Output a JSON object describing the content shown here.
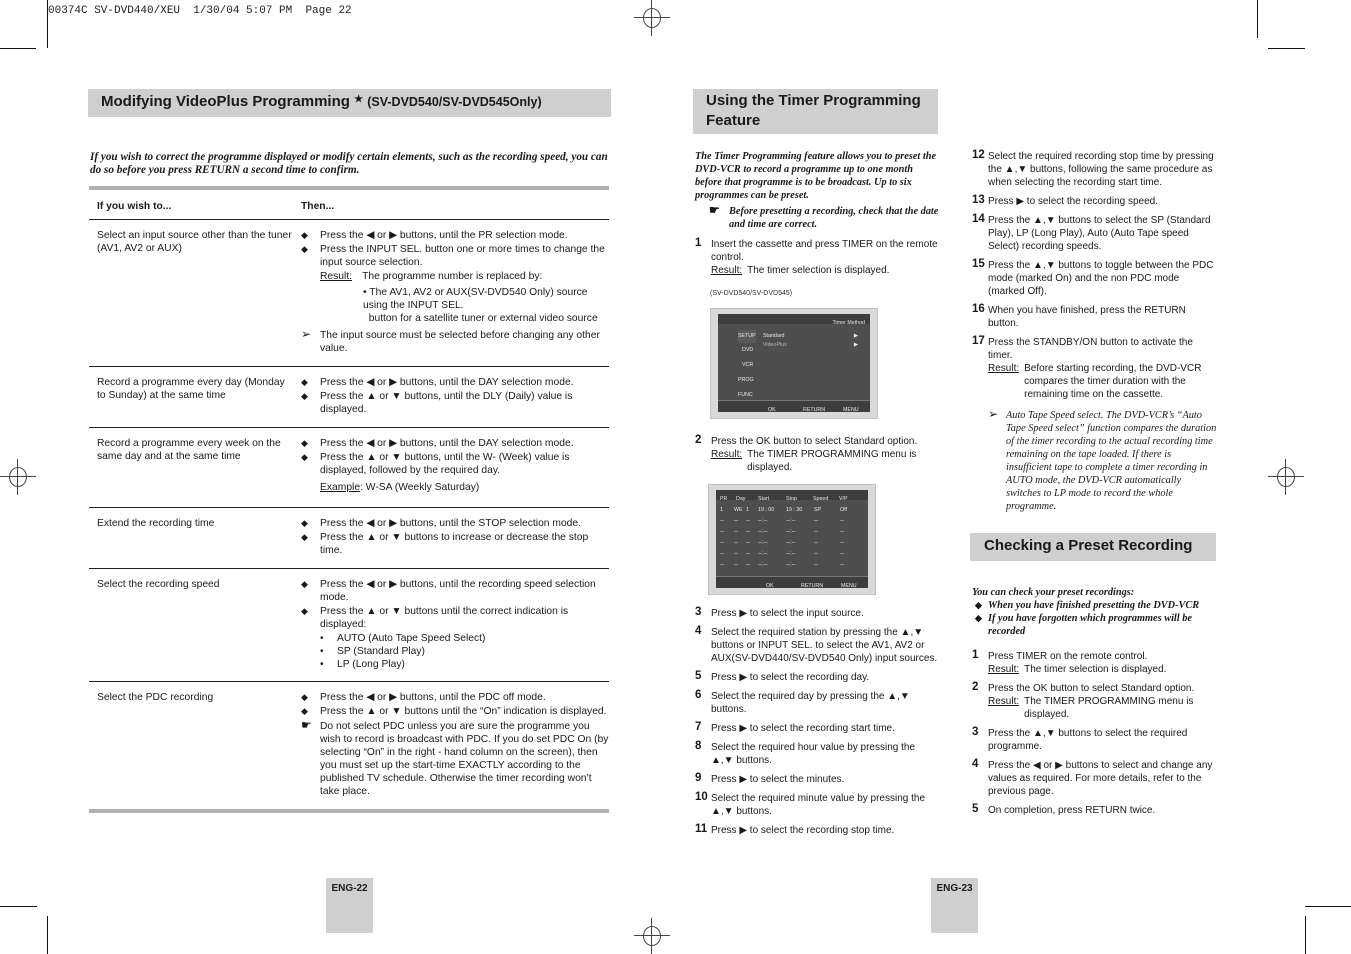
{
  "print_header": "00374C SV-DVD440/XEU  1/30/04 5:07 PM  Page 22",
  "left_page": {
    "title": "Modifying VideoPlus Programming",
    "title_star": "★",
    "title_suffix": "(SV-DVD540/SV-DVD545Only)",
    "intro": "If you wish to correct the programme displayed or modify certain elements, such as the recording speed, you can do so before you press RETURN a second time to confirm.",
    "table": {
      "headers": [
        "If you wish to...",
        "Then..."
      ],
      "rows": [
        {
          "wish": "Select an input source other than the tuner (AV1, AV2 or AUX)",
          "bullets": [
            "Press the ◀ or ▶ buttons, until the PR selection mode.",
            "Press the INPUT SEL. button one or more times to change the input source selection."
          ],
          "result_label": "Result:",
          "result_text": "The programme number is replaced by:",
          "sub_bullet_1": "The AV1, AV2 or AUX(SV-DVD540 Only) source using the INPUT SEL.",
          "sub_bullet_2": "button for a satellite tuner or external video source",
          "note": "The input source must be selected before changing any other value."
        },
        {
          "wish": "Record a programme every day (Monday to Sunday) at the same time",
          "bullets": [
            "Press the ◀ or ▶ buttons, until the DAY selection mode.",
            "Press the ▲ or ▼ buttons, until the DLY (Daily) value is displayed."
          ]
        },
        {
          "wish": "Record a programme every week on the same day and at the same time",
          "bullets": [
            "Press the ◀ or ▶ buttons, until the DAY selection mode.",
            "Press the ▲ or ▼ buttons, until the W- (Week) value is displayed, followed by the required day."
          ],
          "example_label": "Example",
          "example_text": "W-SA (Weekly Saturday)"
        },
        {
          "wish": "Extend the recording time",
          "bullets": [
            "Press the ◀ or ▶ buttons, until the STOP selection mode.",
            "Press the ▲ or ▼ buttons to increase or decrease the stop time."
          ]
        },
        {
          "wish": "Select the recording speed",
          "bullets": [
            "Press the ◀ or ▶ buttons, until the recording speed selection mode.",
            "Press the ▲ or ▼ buttons until the correct indication is displayed:"
          ],
          "speeds": [
            "AUTO (Auto Tape Speed Select)",
            "SP (Standard Play)",
            "LP (Long Play)"
          ]
        },
        {
          "wish": "Select the PDC recording",
          "bullets": [
            "Press the ◀ or ▶ buttons, until the PDC off mode.",
            "Press the ▲ or ▼ buttons until the “On” indication is displayed."
          ],
          "note": "Do not select PDC unless you are sure the programme you wish to record is broadcast with PDC. If you do set PDC On (by selecting “On” in the right - hand column on the screen), then you must set up the start-time EXACTLY according to the published TV schedule. Otherwise the timer recording won’t take place."
        }
      ]
    },
    "page_label": "ENG-22"
  },
  "right_page": {
    "timer_section": {
      "title": "Using the Timer Programming Feature",
      "intro": "The Timer Programming feature allows you to preset the DVD-VCR to record a programme up to one month before that programme is to be broadcast. Up to six programmes can be preset.",
      "note": "Before presetting a recording, check that the date and time are correct.",
      "steps": [
        {
          "n": "1",
          "text": "Insert the cassette and press TIMER on the remote control.",
          "result_label": "Result:",
          "result": "The timer selection is displayed."
        },
        {
          "n": "2",
          "text": "Press the OK button to select Standard option.",
          "result_label": "Result:",
          "result": "The TIMER PROGRAMMING menu is displayed."
        },
        {
          "n": "3",
          "text": "Press ▶ to select the input source."
        },
        {
          "n": "4",
          "text": "Select the required station by pressing the ▲,▼ buttons or INPUT SEL. to select the  AV1, AV2 or AUX(SV-DVD440/SV-DVD540 Only) input sources."
        },
        {
          "n": "5",
          "text": "Press ▶ to select the recording day."
        },
        {
          "n": "6",
          "text": "Select the required day by pressing the ▲,▼ buttons."
        },
        {
          "n": "7",
          "text": "Press ▶ to select the recording start time."
        },
        {
          "n": "8",
          "text": "Select the required hour value by pressing the ▲,▼ buttons."
        },
        {
          "n": "9",
          "text": "Press ▶ to select the minutes."
        },
        {
          "n": "10",
          "text": "Select the required minute value by pressing the ▲,▼ buttons."
        },
        {
          "n": "11",
          "text": "Press ▶ to select the recording stop time."
        },
        {
          "n": "12",
          "text": "Select the required recording stop time by pressing the ▲,▼ buttons, following the same procedure as when selecting the recording start time."
        },
        {
          "n": "13",
          "text": "Press ▶ to select the recording speed."
        },
        {
          "n": "14",
          "text": "Press the ▲,▼ buttons to select the SP (Standard Play), LP (Long Play), Auto (Auto Tape speed Select) recording speeds."
        },
        {
          "n": "15",
          "text": "Press the ▲,▼ buttons to toggle between the PDC mode (marked On) and the non PDC mode (marked Off)."
        },
        {
          "n": "16",
          "text": "When you have finished, press the RETURN button."
        },
        {
          "n": "17",
          "text": "Press the STANDBY/ON button to activate the timer.",
          "result_label": "Result:",
          "result": "Before starting recording, the DVD-VCR compares the timer duration with the remaining time on the cassette."
        }
      ],
      "model_note": "(SV-DVD540/SV-DVD545)",
      "auto_note": "Auto Tape Speed select. The DVD-VCR’s “Auto Tape Speed select” function compares the duration of the timer recording to the actual recording time remaining on the tape loaded. If there is insufficient tape to complete a timer recording in AUTO mode, the DVD-VCR automatically switches to LP mode to record the whole programme."
    },
    "screen_timer_method": {
      "header": "Timer Method",
      "menu_items": [
        "SETUP",
        "DVD",
        "VCR",
        "PROG",
        "FUNC"
      ],
      "options": [
        "Standard",
        "VideoPlus"
      ],
      "footer": [
        "OK",
        "RETURN",
        "MENU"
      ]
    },
    "screen_timer_programming": {
      "columns": [
        "PR",
        "Day",
        "Start",
        "Stop",
        "Speed",
        "V/P"
      ],
      "first_row": [
        "1",
        "WE",
        "1",
        "19 : 00",
        "19 : 30",
        "SP",
        "Off"
      ],
      "empty_row": [
        "--",
        "--",
        "--",
        "--:--",
        "--:--",
        "--",
        "--"
      ],
      "empty_rows_count": 5,
      "footer": [
        "OK",
        "RETURN",
        "MENU"
      ]
    },
    "check_section": {
      "title": "Checking a Preset Recording",
      "intro": "You can check your preset recordings:",
      "bullets": [
        "When you have finished presetting the DVD-VCR",
        "If you have forgotten which programmes will be recorded"
      ],
      "steps": [
        {
          "n": "1",
          "text": "Press TIMER on the remote control.",
          "result_label": "Result:",
          "result": "The timer selection is displayed."
        },
        {
          "n": "2",
          "text": "Press the OK button to select Standard option.",
          "result_label": "Result:",
          "result": "The TIMER PROGRAMMING menu is displayed."
        },
        {
          "n": "3",
          "text": "Press the ▲,▼ buttons to select the required programme."
        },
        {
          "n": "4",
          "text": "Press the ◀ or ▶ buttons to select and change any values as required. For more details, refer to the previous page."
        },
        {
          "n": "5",
          "text": "On completion, press RETURN twice."
        }
      ]
    },
    "page_label": "ENG-23"
  }
}
